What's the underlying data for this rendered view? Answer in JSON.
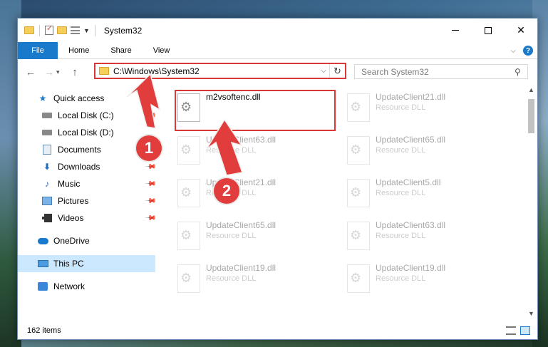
{
  "window": {
    "title": "System32",
    "controls": {
      "minimize": "",
      "maximize": "",
      "close": "✕"
    }
  },
  "ribbon": {
    "tabs": [
      "File",
      "Home",
      "Share",
      "View"
    ],
    "collapse_icon": "chevron-down-icon",
    "help_label": "?"
  },
  "nav": {
    "back": "←",
    "forward": "→",
    "recent": "▾",
    "up": "↑",
    "address": "C:\\Windows\\System32",
    "address_drop": "⌵",
    "refresh": "↻",
    "search_placeholder": "Search System32",
    "search_glyph": "⚲"
  },
  "sidebar": {
    "items": [
      {
        "label": "Quick access",
        "icon": "star-icon",
        "pinned": false
      },
      {
        "label": "Local Disk (C:)",
        "icon": "disk-icon",
        "pinned": true
      },
      {
        "label": "Local Disk (D:)",
        "icon": "disk-icon",
        "pinned": false
      },
      {
        "label": "Documents",
        "icon": "documents-icon",
        "pinned": true
      },
      {
        "label": "Downloads",
        "icon": "download-icon",
        "pinned": true
      },
      {
        "label": "Music",
        "icon": "music-icon",
        "pinned": true
      },
      {
        "label": "Pictures",
        "icon": "pictures-icon",
        "pinned": true
      },
      {
        "label": "Videos",
        "icon": "videos-icon",
        "pinned": true
      },
      {
        "label": "OneDrive",
        "icon": "onedrive-icon",
        "pinned": false
      },
      {
        "label": "This PC",
        "icon": "pc-icon",
        "pinned": false,
        "selected": true
      },
      {
        "label": "Network",
        "icon": "network-icon",
        "pinned": false
      }
    ]
  },
  "files": [
    {
      "name": "m2vsoftenc.dll",
      "type": "",
      "faded": false,
      "highlighted": true
    },
    {
      "name": "UpdateClient21.dll",
      "type": "Resource DLL",
      "faded": true
    },
    {
      "name": "UpdateClient63.dll",
      "type": "Resource DLL",
      "faded": true
    },
    {
      "name": "UpdateClient65.dll",
      "type": "Resource DLL",
      "faded": true
    },
    {
      "name": "UpdateClient21.dll",
      "type": "Resource DLL",
      "faded": true
    },
    {
      "name": "UpdateClient5.dll",
      "type": "Resource DLL",
      "faded": true
    },
    {
      "name": "UpdateClient65.dll",
      "type": "Resource DLL",
      "faded": true
    },
    {
      "name": "UpdateClient63.dll",
      "type": "Resource DLL",
      "faded": true
    },
    {
      "name": "UpdateClient19.dll",
      "type": "Resource DLL",
      "faded": true
    },
    {
      "name": "UpdateClient19.dll",
      "type": "Resource DLL",
      "faded": true
    }
  ],
  "status": {
    "item_count": "162 items"
  },
  "callouts": [
    "1",
    "2"
  ],
  "colors": {
    "accent": "#1979ca",
    "callout": "#e23d3d",
    "selection": "#cce8ff"
  }
}
